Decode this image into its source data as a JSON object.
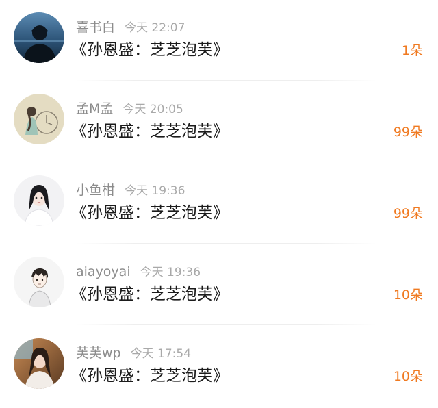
{
  "comments": [
    {
      "name": "喜书白",
      "time": "今天 22:07",
      "title": "《孙恩盛：芝芝泡芙》",
      "count": "1朵",
      "avatar_icon": "man-silhouette-sky-avatar-icon"
    },
    {
      "name": "孟M孟",
      "time": "今天 20:05",
      "title": "《孙恩盛：芝芝泡芙》",
      "count": "99朵",
      "avatar_icon": "girl-with-clock-illustration-avatar-icon"
    },
    {
      "name": "小鱼柑",
      "time": "今天 19:36",
      "title": "《孙恩盛：芝芝泡芙》",
      "count": "99朵",
      "avatar_icon": "anime-girl-black-hair-avatar-icon"
    },
    {
      "name": "aiayoyai",
      "time": "今天 19:36",
      "title": "《孙恩盛：芝芝泡芙》",
      "count": "10朵",
      "avatar_icon": "anime-boy-sketch-avatar-icon"
    },
    {
      "name": "芙芙wp",
      "time": "今天 17:54",
      "title": "《孙恩盛：芝芝泡芙》",
      "count": "10朵",
      "avatar_icon": "girl-photo-avatar-icon"
    }
  ],
  "colors": {
    "name": "#8c8c8c",
    "time": "#a9a9a9",
    "title": "#1b1b1b",
    "count_accent": "#f07a21"
  }
}
